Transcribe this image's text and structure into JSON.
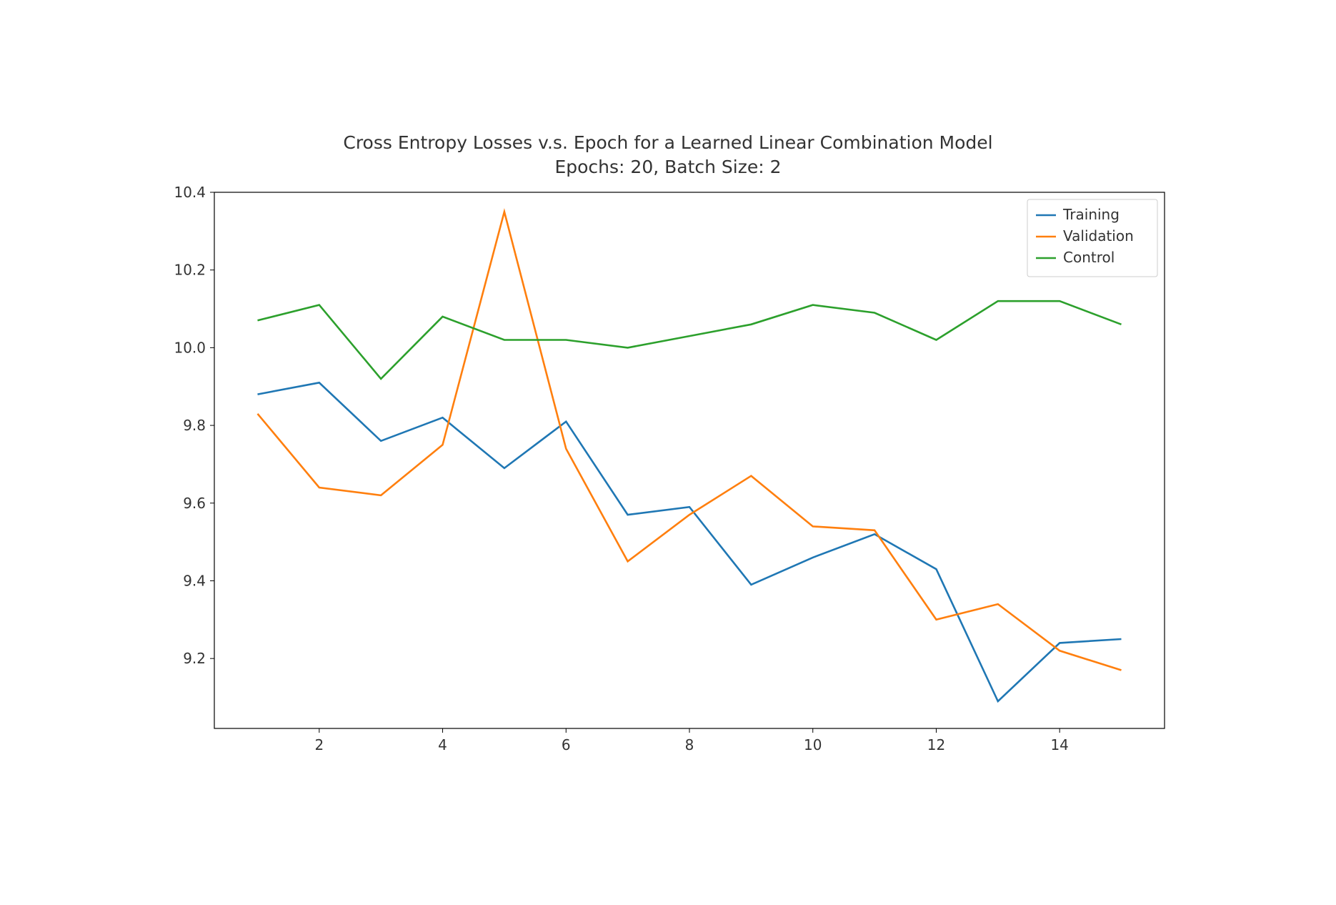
{
  "chart_data": {
    "type": "line",
    "title_line1": "Cross Entropy Losses v.s. Epoch for a Learned Linear Combination Model",
    "title_line2": "Epochs: 20, Batch Size: 2",
    "xlabel": "",
    "ylabel": "",
    "x": [
      1,
      2,
      3,
      4,
      5,
      6,
      7,
      8,
      9,
      10,
      11,
      12,
      13,
      14,
      15
    ],
    "x_ticks": [
      2,
      4,
      6,
      8,
      10,
      12,
      14
    ],
    "y_ticks": [
      9.2,
      9.4,
      9.6,
      9.8,
      10.0,
      10.2,
      10.4
    ],
    "ylim": [
      9.02,
      10.4
    ],
    "xlim": [
      0.3,
      15.7
    ],
    "series": [
      {
        "name": "Training",
        "color": "#1f77b4",
        "values": [
          9.88,
          9.91,
          9.76,
          9.82,
          9.69,
          9.81,
          9.57,
          9.59,
          9.39,
          9.46,
          9.52,
          9.43,
          9.09,
          9.24,
          9.25
        ]
      },
      {
        "name": "Validation",
        "color": "#ff7f0e",
        "values": [
          9.83,
          9.64,
          9.62,
          9.75,
          10.35,
          9.74,
          9.45,
          9.57,
          9.67,
          9.54,
          9.53,
          9.3,
          9.34,
          9.22,
          9.17
        ]
      },
      {
        "name": "Control",
        "color": "#2ca02c",
        "values": [
          10.07,
          10.11,
          9.92,
          10.08,
          10.02,
          10.02,
          10.0,
          10.03,
          10.06,
          10.11,
          10.09,
          10.02,
          10.12,
          10.12,
          10.06
        ]
      }
    ]
  }
}
